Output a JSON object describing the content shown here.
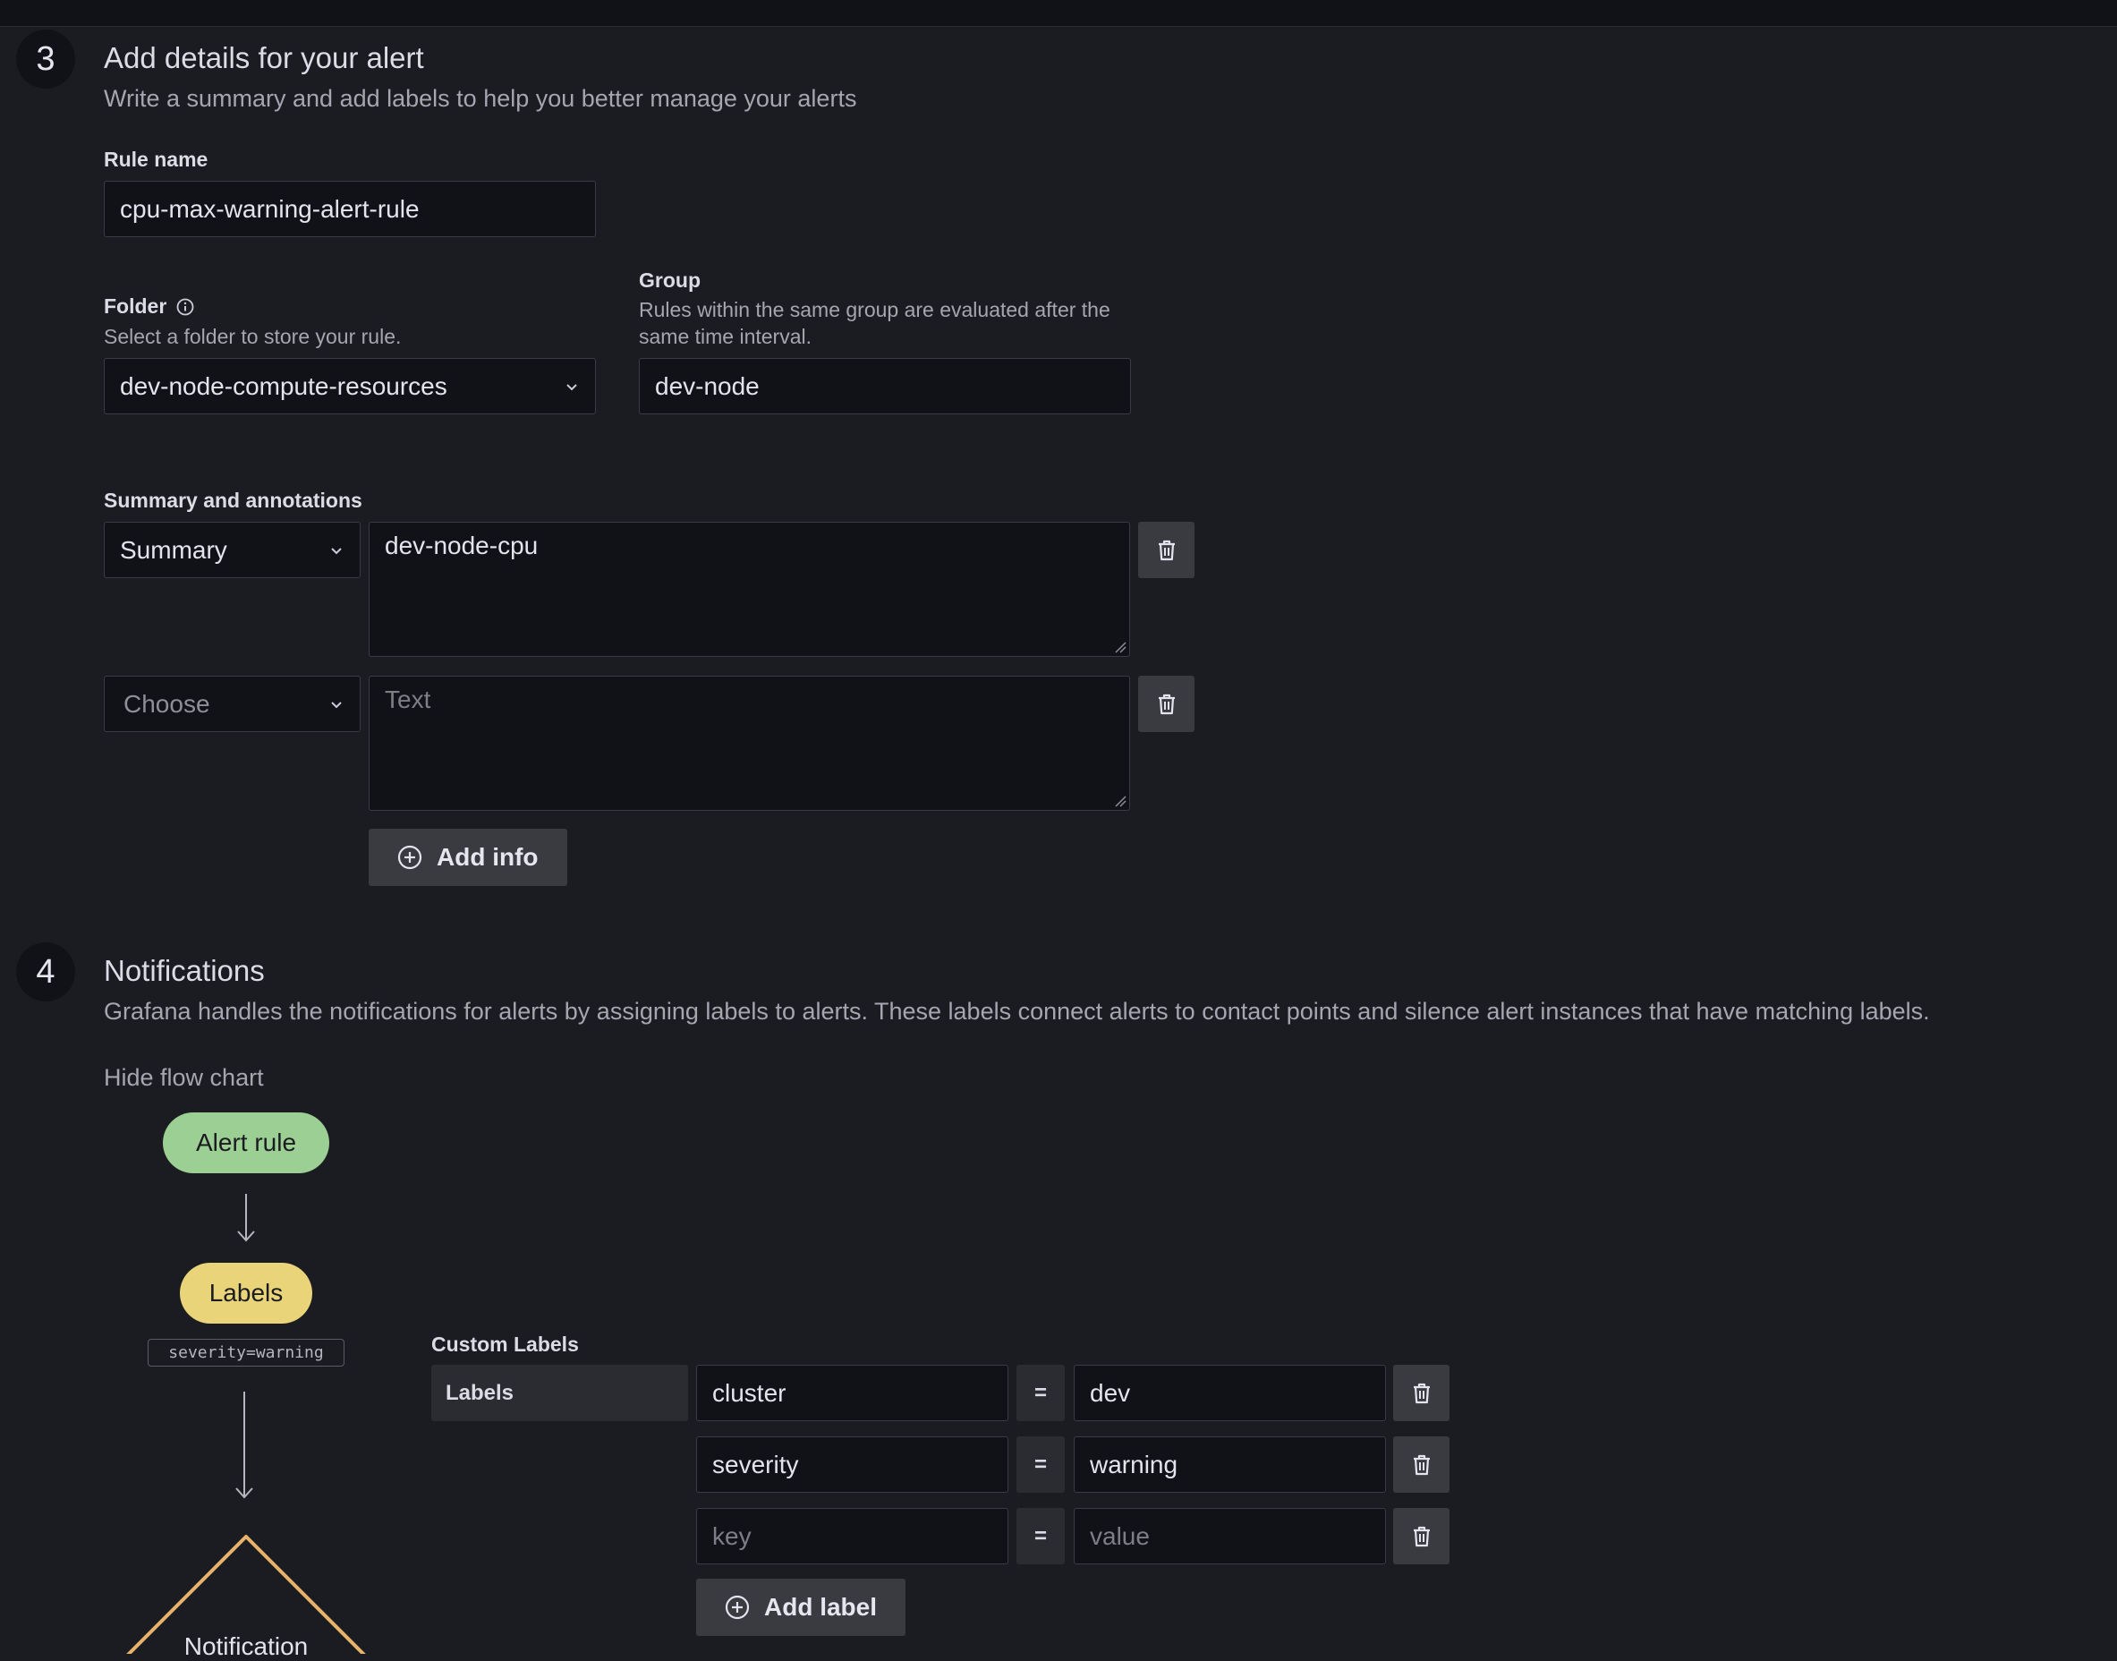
{
  "step3": {
    "number": "3",
    "title": "Add details for your alert",
    "description": "Write a summary and add labels to help you better manage your alerts",
    "rule_name_label": "Rule name",
    "rule_name_value": "cpu-max-warning-alert-rule",
    "folder_label": "Folder",
    "folder_hint": "Select a folder to store your rule.",
    "folder_value": "dev-node-compute-resources",
    "group_label": "Group",
    "group_hint": "Rules within the same group are evaluated after the same time interval.",
    "group_value": "dev-node",
    "annotations_label": "Summary and annotations",
    "annotations": [
      {
        "type": "Summary",
        "text": "dev-node-cpu"
      },
      {
        "type_placeholder": "Choose",
        "text_placeholder": "Text"
      }
    ],
    "add_info_label": "Add info"
  },
  "step4": {
    "number": "4",
    "title": "Notifications",
    "description": "Grafana handles the notifications for alerts by assigning labels to alerts. These labels connect alerts to contact points and silence alert instances that have matching labels.",
    "hide_flow_chart": "Hide flow chart",
    "flow": {
      "alert_rule": "Alert rule",
      "labels": "Labels",
      "label_chip": "severity=warning",
      "notification": "Notification"
    },
    "custom_labels_title": "Custom Labels",
    "labels_column": "Labels",
    "labels": [
      {
        "key": "cluster",
        "value": "dev"
      },
      {
        "key": "severity",
        "value": "warning"
      },
      {
        "key_placeholder": "key",
        "value_placeholder": "value"
      }
    ],
    "equals": "=",
    "add_label_label": "Add label"
  },
  "colors": {
    "background": "#1b1c21",
    "input_bg": "#111217",
    "alert_rule_pill": "#9ccf93",
    "labels_pill": "#e9d479",
    "notification_border": "#e7b36a"
  },
  "icons": [
    "info-icon",
    "chevron-down-icon",
    "trash-icon",
    "plus-circle-icon",
    "arrow-down-icon"
  ]
}
